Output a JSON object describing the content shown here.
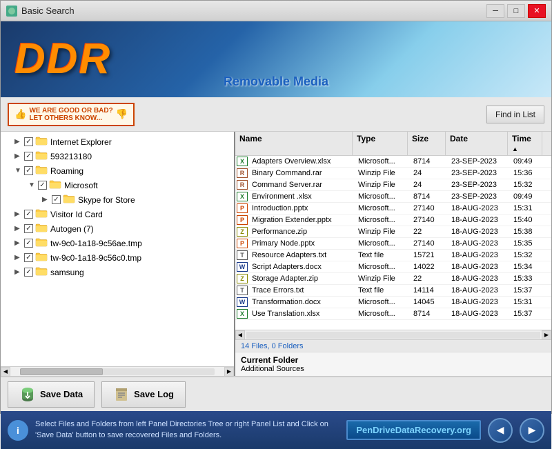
{
  "titlebar": {
    "title": "Basic Search",
    "minimize": "─",
    "maximize": "□",
    "close": "✕"
  },
  "header": {
    "logo": "DDR",
    "subtitle": "Removable Media"
  },
  "toolbar": {
    "badge_line1": "WE ARE GOOD OR BAD?",
    "badge_line2": "LET OTHERS KNOW...",
    "find_in_list": "Find in List"
  },
  "tree": {
    "items": [
      {
        "label": "Internet Explorer",
        "indent": 1,
        "checked": true,
        "expanded": false
      },
      {
        "label": "593213180",
        "indent": 1,
        "checked": true,
        "expanded": false
      },
      {
        "label": "Roaming",
        "indent": 1,
        "checked": true,
        "expanded": true
      },
      {
        "label": "Microsoft",
        "indent": 2,
        "checked": true,
        "expanded": true
      },
      {
        "label": "Skype for Store",
        "indent": 3,
        "checked": true,
        "expanded": false
      },
      {
        "label": "Visitor Id Card",
        "indent": 1,
        "checked": true,
        "expanded": false
      },
      {
        "label": "Autogen (7)",
        "indent": 1,
        "checked": true,
        "expanded": false
      },
      {
        "label": "tw-9c0-1a18-9c56ae.tmp",
        "indent": 1,
        "checked": true,
        "expanded": false
      },
      {
        "label": "tw-9c0-1a18-9c56c0.tmp",
        "indent": 1,
        "checked": true,
        "expanded": false
      },
      {
        "label": "samsung",
        "indent": 1,
        "checked": true,
        "expanded": false
      }
    ]
  },
  "file_list": {
    "columns": [
      "Name",
      "Type",
      "Size",
      "Date",
      "Time"
    ],
    "files": [
      {
        "name": "Adapters Overview.xlsx",
        "type": "Microsoft...",
        "size": "8714",
        "date": "23-SEP-2023",
        "time": "09:49",
        "ext": "xlsx"
      },
      {
        "name": "Binary Command.rar",
        "type": "Winzip File",
        "size": "24",
        "date": "23-SEP-2023",
        "time": "15:36",
        "ext": "rar"
      },
      {
        "name": "Command Server.rar",
        "type": "Winzip File",
        "size": "24",
        "date": "23-SEP-2023",
        "time": "15:32",
        "ext": "rar"
      },
      {
        "name": "Environment .xlsx",
        "type": "Microsoft...",
        "size": "8714",
        "date": "23-SEP-2023",
        "time": "09:49",
        "ext": "xlsx"
      },
      {
        "name": "Introduction.pptx",
        "type": "Microsoft...",
        "size": "27140",
        "date": "18-AUG-2023",
        "time": "15:31",
        "ext": "pptx"
      },
      {
        "name": "Migration Extender.pptx",
        "type": "Microsoft...",
        "size": "27140",
        "date": "18-AUG-2023",
        "time": "15:40",
        "ext": "pptx"
      },
      {
        "name": "Performance.zip",
        "type": "Winzip File",
        "size": "22",
        "date": "18-AUG-2023",
        "time": "15:38",
        "ext": "zip"
      },
      {
        "name": "Primary Node.pptx",
        "type": "Microsoft...",
        "size": "27140",
        "date": "18-AUG-2023",
        "time": "15:35",
        "ext": "pptx"
      },
      {
        "name": "Resource Adapters.txt",
        "type": "Text file",
        "size": "15721",
        "date": "18-AUG-2023",
        "time": "15:32",
        "ext": "txt"
      },
      {
        "name": "Script Adapters.docx",
        "type": "Microsoft...",
        "size": "14022",
        "date": "18-AUG-2023",
        "time": "15:34",
        "ext": "docx"
      },
      {
        "name": "Storage Adapter.zip",
        "type": "Winzip File",
        "size": "22",
        "date": "18-AUG-2023",
        "time": "15:33",
        "ext": "zip"
      },
      {
        "name": "Trace Errors.txt",
        "type": "Text file",
        "size": "14114",
        "date": "18-AUG-2023",
        "time": "15:37",
        "ext": "txt"
      },
      {
        "name": "Transformation.docx",
        "type": "Microsoft...",
        "size": "14045",
        "date": "18-AUG-2023",
        "time": "15:31",
        "ext": "docx"
      },
      {
        "name": "Use Translation.xlsx",
        "type": "Microsoft...",
        "size": "8714",
        "date": "18-AUG-2023",
        "time": "15:37",
        "ext": "xlsx"
      }
    ],
    "status": "14 Files, 0 Folders"
  },
  "current_folder": {
    "label": "Current Folder",
    "value": "Additional Sources"
  },
  "buttons": {
    "save_data": "Save Data",
    "save_log": "Save Log"
  },
  "status_bar": {
    "message": "Select Files and Folders from left Panel Directories Tree or right Panel List and Click on 'Save Data' button to save recovered Files\nand Folders.",
    "website": "PenDriveDataRecovery.org"
  },
  "nav": {
    "back": "◀",
    "forward": "▶"
  }
}
